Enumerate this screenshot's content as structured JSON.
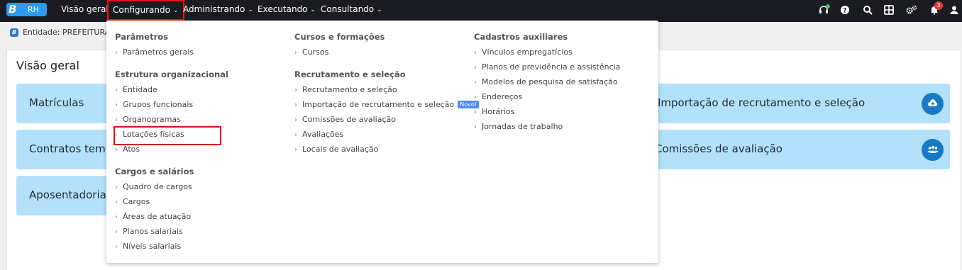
{
  "app": {
    "logo_letter": "B",
    "logo_text": "RH"
  },
  "nav": {
    "items": [
      {
        "label": "Visão geral",
        "has_menu": false
      },
      {
        "label": "Configurando",
        "has_menu": true,
        "active": true
      },
      {
        "label": "Administrando",
        "has_menu": true
      },
      {
        "label": "Executando",
        "has_menu": true
      },
      {
        "label": "Consultando",
        "has_menu": true
      }
    ],
    "chevron": "⌄",
    "notifications_count": "3"
  },
  "entity": {
    "icon_letter": "B",
    "text": "Entidade: PREFEITURA D"
  },
  "page": {
    "title": "Visão geral",
    "tiles_left": [
      "Matrículas",
      "Contratos temp",
      "Aposentadorias"
    ],
    "tiles_right": [
      "Importação de recrutamento e seleção",
      "Comissões de avaliação"
    ]
  },
  "menu": {
    "col1": {
      "sections": [
        {
          "title": "Parâmetros",
          "items": [
            "Parâmetros gerais"
          ]
        },
        {
          "title": "Estrutura organizacional",
          "items": [
            "Entidade",
            "Grupos funcionais",
            "Organogramas",
            "Lotações físicas",
            "Atos"
          ]
        },
        {
          "title": "Cargos e salários",
          "items": [
            "Quadro de cargos",
            "Cargos",
            "Áreas de atuação",
            "Planos salariais",
            "Níveis salariais"
          ]
        }
      ]
    },
    "col2": {
      "sections": [
        {
          "title": "Cursos e formações",
          "items": [
            "Cursos"
          ]
        },
        {
          "title": "Recrutamento e seleção",
          "items": [
            "Recrutamento e seleção",
            "Importação de recrutamento e seleção",
            "Comissões de avaliação",
            "Avaliações",
            "Locais de avaliação"
          ]
        }
      ],
      "new_badge": "Novo!"
    },
    "col3": {
      "sections": [
        {
          "title": "Cadastros auxiliares",
          "items": [
            "Vínculos empregatícios",
            "Planos de previdência e assistência",
            "Modelos de pesquisa de satisfação",
            "Endereços",
            "Horários",
            "Jornadas de trabalho"
          ]
        }
      ]
    },
    "arrow": "›"
  },
  "colors": {
    "topbar": "#1b1c21",
    "tile": "#b3e1fb",
    "accent": "#1779c6",
    "highlight": "#d4141b"
  }
}
